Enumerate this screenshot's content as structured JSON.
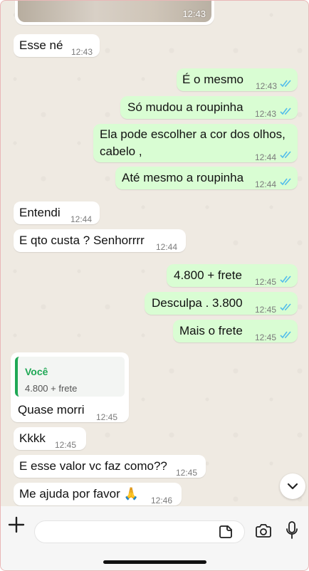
{
  "image_message": {
    "time": "12:43"
  },
  "messages": [
    {
      "dir": "in",
      "text": "Esse né",
      "time": "12:43"
    },
    {
      "dir": "out",
      "text": "É o mesmo",
      "time": "12:43"
    },
    {
      "dir": "out",
      "text": "Só mudou a roupinha",
      "time": "12:43"
    },
    {
      "dir": "out",
      "text_line1": "Ela pode escolher a cor dos olhos,",
      "text_line2": "cabelo ,",
      "time": "12:44"
    },
    {
      "dir": "out",
      "text": "Até mesmo a roupinha",
      "time": "12:44"
    },
    {
      "dir": "in",
      "text": "Entendi",
      "time": "12:44"
    },
    {
      "dir": "in",
      "text": "E qto custa ? Senhorrrr",
      "time": "12:44"
    },
    {
      "dir": "out",
      "text": "4.800 + frete",
      "time": "12:45"
    },
    {
      "dir": "out",
      "text": "Desculpa . 3.800",
      "time": "12:45"
    },
    {
      "dir": "out",
      "text": "Mais o frete",
      "time": "12:45"
    },
    {
      "dir": "in",
      "reply_author": "Você",
      "reply_text": "4.800 + frete",
      "text": "Quase morri",
      "time": "12:45"
    },
    {
      "dir": "in",
      "text": "Kkkk",
      "time": "12:45"
    },
    {
      "dir": "in",
      "text": "E esse valor vc faz como??",
      "time": "12:45"
    },
    {
      "dir": "in",
      "text": "Me ajuda por favor 🙏",
      "time": "12:46"
    }
  ],
  "icons": [
    "plus-icon",
    "sticker-icon",
    "camera-icon",
    "mic-icon",
    "chevron-down-icon",
    "double-check-icon"
  ],
  "colors": {
    "incoming": "#ffffff",
    "outgoing": "#d9fdd3",
    "read_ticks": "#53bdeb",
    "reply_accent": "#1fa855",
    "background": "#efeae2"
  }
}
